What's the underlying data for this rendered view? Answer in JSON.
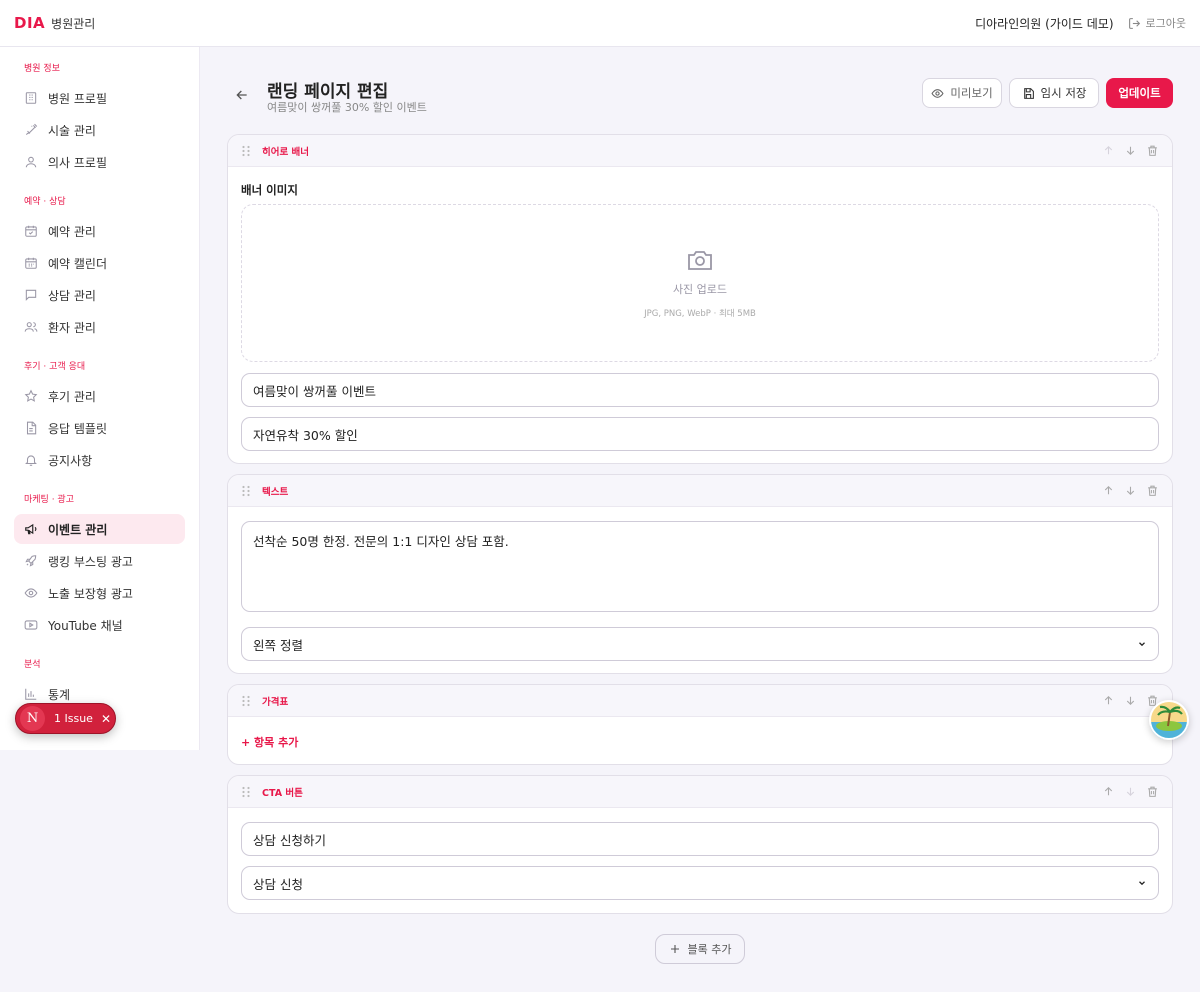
{
  "header": {
    "logo": "DIA",
    "app_name": "병원관리",
    "clinic_name": "디아라인의원 (가이드 데모)",
    "logout_label": "로그아웃"
  },
  "sidebar": {
    "groups": [
      {
        "title": "병원 정보",
        "items": [
          {
            "label": "병원 프로필",
            "icon": "building-icon"
          },
          {
            "label": "시술 관리",
            "icon": "syringe-icon"
          },
          {
            "label": "의사 프로필",
            "icon": "user-icon"
          }
        ]
      },
      {
        "title": "예약 · 상담",
        "items": [
          {
            "label": "예약 관리",
            "icon": "calendar-check-icon"
          },
          {
            "label": "예약 캘린더",
            "icon": "calendar-icon"
          },
          {
            "label": "상담 관리",
            "icon": "chat-icon"
          },
          {
            "label": "환자 관리",
            "icon": "users-icon"
          }
        ]
      },
      {
        "title": "후기 · 고객 응대",
        "items": [
          {
            "label": "후기 관리",
            "icon": "star-icon"
          },
          {
            "label": "응답 템플릿",
            "icon": "file-icon"
          },
          {
            "label": "공지사항",
            "icon": "bell-icon"
          }
        ]
      },
      {
        "title": "마케팅 · 광고",
        "items": [
          {
            "label": "이벤트 관리",
            "icon": "megaphone-icon",
            "active": true
          },
          {
            "label": "랭킹 부스팅 광고",
            "icon": "rocket-icon"
          },
          {
            "label": "노출 보장형 광고",
            "icon": "eye-icon"
          },
          {
            "label": "YouTube 채널",
            "icon": "play-icon"
          }
        ]
      },
      {
        "title": "분석",
        "items": [
          {
            "label": "통계",
            "icon": "bar-chart-icon"
          }
        ]
      }
    ]
  },
  "issue_pill": {
    "badge": "N",
    "label": "1 Issue"
  },
  "page": {
    "title": "랜딩 페이지 편집",
    "subtitle": "여름맞이 쌍꺼풀 30% 할인 이벤트",
    "preview_label": "미리보기",
    "save_label": "임시 저장",
    "update_label": "업데이트"
  },
  "blocks": {
    "hero": {
      "label": "히어로 배너",
      "image_label": "배너 이미지",
      "upload_title": "사진 업로드",
      "upload_hint": "JPG, PNG, WebP · 최대 5MB",
      "title_value": "여름맞이 쌍꺼풀 이벤트",
      "subtitle_value": "자연유착 30% 할인"
    },
    "text": {
      "label": "텍스트",
      "body_value": "선착순 50명 한정. 전문의 1:1 디자인 상담 포함.",
      "align_value": "왼쪽 정렬"
    },
    "price": {
      "label": "가격표",
      "add_item_label": "+ 항목 추가"
    },
    "cta": {
      "label": "CTA 버튼",
      "button_text_value": "상담 신청하기",
      "action_value": "상담 신청"
    }
  },
  "add_block_label": "블록 추가",
  "colors": {
    "accent": "#e8184a",
    "active_bg": "#fde9ef",
    "page_bg": "#f5f4fa"
  }
}
